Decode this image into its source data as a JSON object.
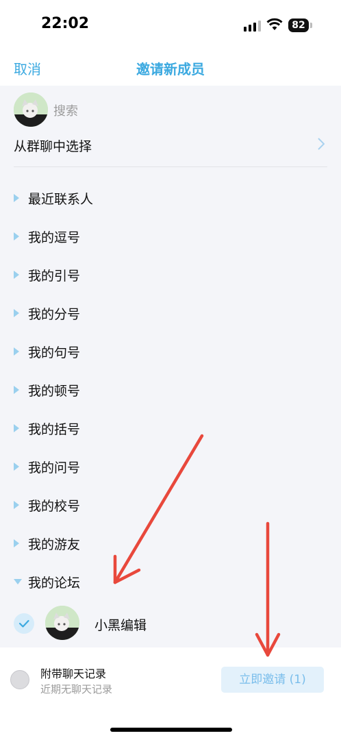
{
  "status_bar": {
    "time": "22:02",
    "battery": "82"
  },
  "nav": {
    "cancel": "取消",
    "title": "邀请新成员"
  },
  "search": {
    "placeholder": "搜索"
  },
  "group_select": {
    "label": "从群聊中选择"
  },
  "groups": [
    {
      "label": "最近联系人",
      "expanded": false
    },
    {
      "label": "我的逗号",
      "expanded": false
    },
    {
      "label": "我的引号",
      "expanded": false
    },
    {
      "label": "我的分号",
      "expanded": false
    },
    {
      "label": "我的句号",
      "expanded": false
    },
    {
      "label": "我的顿号",
      "expanded": false
    },
    {
      "label": "我的括号",
      "expanded": false
    },
    {
      "label": "我的问号",
      "expanded": false
    },
    {
      "label": "我的校号",
      "expanded": false
    },
    {
      "label": "我的游友",
      "expanded": false
    },
    {
      "label": "我的论坛",
      "expanded": true
    }
  ],
  "member": {
    "name": "小黑编辑",
    "selected": true
  },
  "bottom": {
    "history_title": "附带聊天记录",
    "history_sub": "近期无聊天记录",
    "invite_button": "立即邀请 (1)"
  },
  "colors": {
    "accent": "#3BA9E0",
    "annotation_arrow": "#E8483C"
  }
}
